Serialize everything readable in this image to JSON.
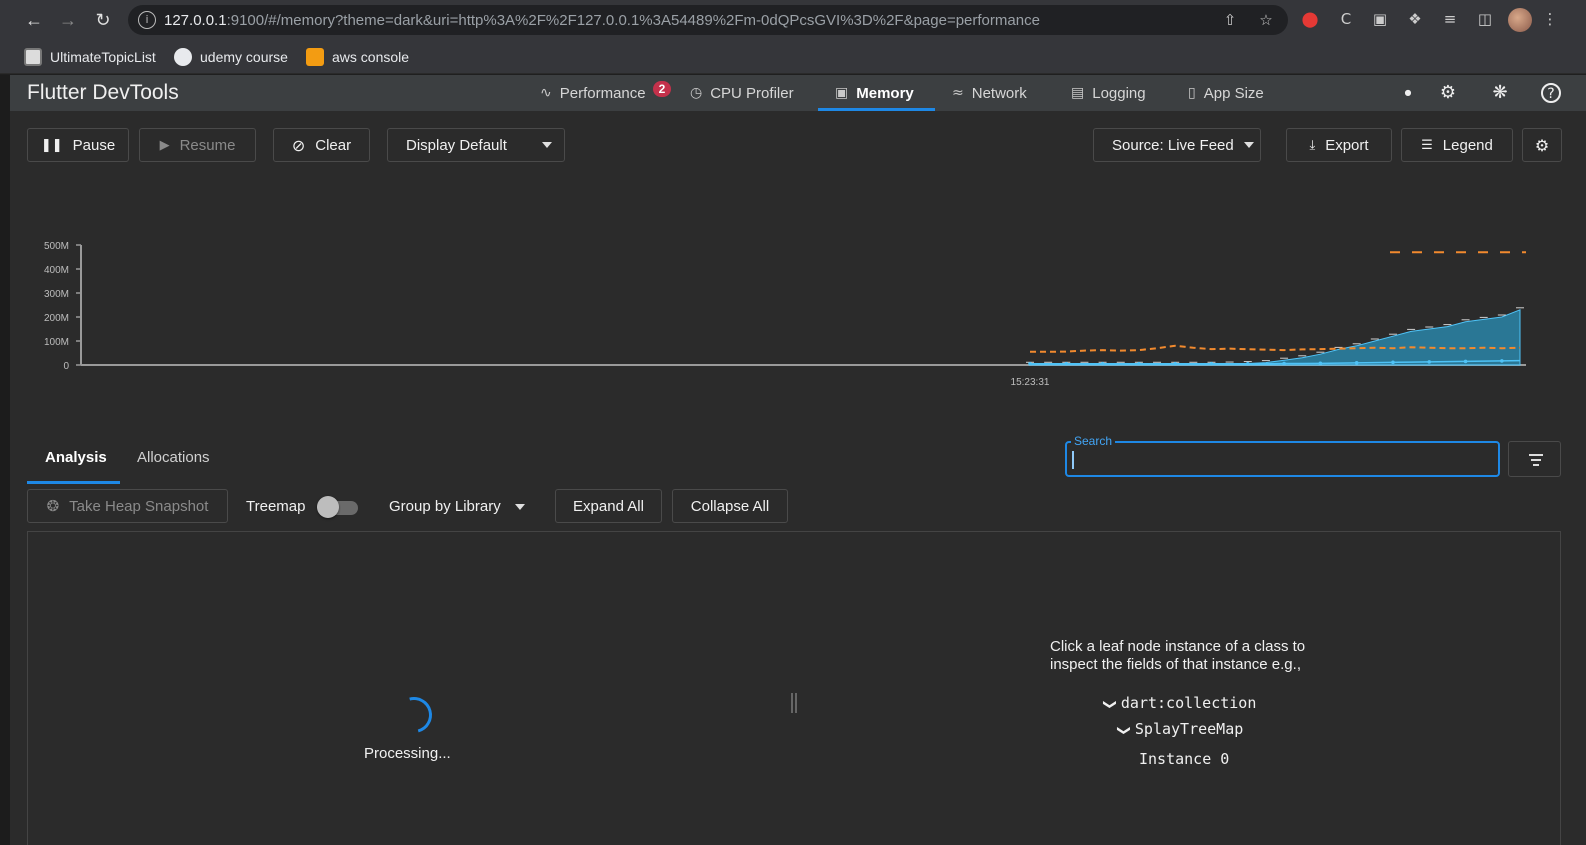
{
  "browser": {
    "url_host": "127.0.0.1",
    "url_rest": ":9100/#/memory?theme=dark&uri=http%3A%2F%2F127.0.0.1%3A54489%2Fm-0dQPcsGVI%3D%2F&page=performance",
    "bookmarks": [
      {
        "label": "UltimateTopicList",
        "icon": "bookmark-page-icon"
      },
      {
        "label": "udemy course",
        "icon": "github-icon"
      },
      {
        "label": "aws console",
        "icon": "aws-cube-icon"
      }
    ]
  },
  "app": {
    "title": "Flutter DevTools",
    "tabs": [
      {
        "label": "Performance",
        "icon": "pulse-icon",
        "badge": "2"
      },
      {
        "label": "CPU Profiler",
        "icon": "gauge-icon"
      },
      {
        "label": "Memory",
        "icon": "memory-icon",
        "active": true
      },
      {
        "label": "Network",
        "icon": "wifi-icon"
      },
      {
        "label": "Logging",
        "icon": "clipboard-icon"
      },
      {
        "label": "App Size",
        "icon": "file-icon"
      }
    ]
  },
  "toolbar": {
    "pause": "Pause",
    "resume": "Resume",
    "clear": "Clear",
    "display": "Display Default",
    "source": "Source: Live Feed",
    "export": "Export",
    "legend": "Legend"
  },
  "chart_data": {
    "type": "area",
    "y_tick_labels": [
      "500M",
      "400M",
      "300M",
      "200M",
      "100M",
      "0"
    ],
    "ylim": [
      0,
      500
    ],
    "x_tick_labels": [
      "15:23:31"
    ],
    "series": [
      {
        "color": "#2b8bb0",
        "values": [
          3,
          3,
          3,
          3,
          3,
          3,
          3,
          3,
          3,
          3,
          3,
          4,
          6,
          10,
          20,
          30,
          45,
          65,
          80,
          100,
          120,
          140,
          150,
          160,
          180,
          190,
          200,
          230
        ]
      },
      {
        "color": "#f28a2e",
        "values": [
          55,
          55,
          56,
          60,
          62,
          60,
          62,
          70,
          80,
          72,
          66,
          68,
          66,
          64,
          62,
          65,
          66,
          68,
          70,
          72,
          70,
          74,
          72,
          70,
          70,
          72,
          70,
          72
        ]
      },
      {
        "color": "#4fc3f7",
        "values": [
          5,
          5,
          5,
          5,
          5,
          5,
          5,
          5,
          5,
          5,
          5,
          5,
          5,
          5,
          6,
          6,
          7,
          8,
          9,
          10,
          11,
          12,
          13,
          14,
          15,
          16,
          17,
          18
        ]
      }
    ],
    "top_dash_value": 470,
    "grid": false
  },
  "lower": {
    "tabs": [
      "Analysis",
      "Allocations"
    ],
    "search_label": "Search",
    "take_snapshot": "Take Heap Snapshot",
    "treemap": "Treemap",
    "group_by": "Group by Library",
    "expand_all": "Expand All",
    "collapse_all": "Collapse All",
    "processing": "Processing...",
    "hint_line1": "Click a leaf node instance of a class to",
    "hint_line2": "inspect the fields of that instance e.g.,",
    "tree_lib": "dart:collection",
    "tree_class": "SplayTreeMap",
    "tree_instance": "Instance 0"
  }
}
